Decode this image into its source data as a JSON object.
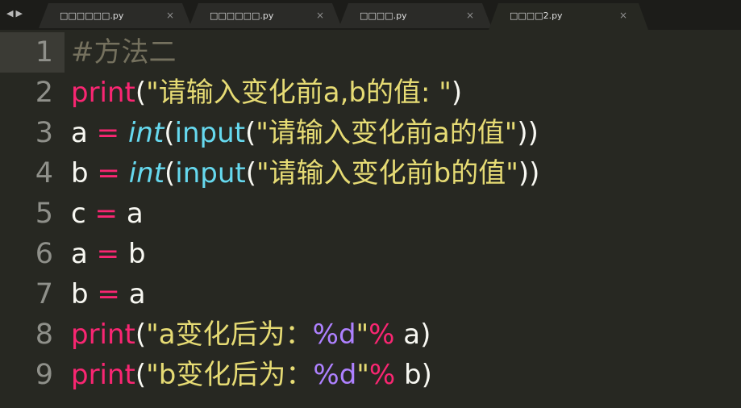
{
  "tabs": [
    {
      "label": "□□□□□□.py",
      "close": "×",
      "active": false
    },
    {
      "label": "□□□□□□.py",
      "close": "×",
      "active": false
    },
    {
      "label": "□□□□.py",
      "close": "×",
      "active": false
    },
    {
      "label": "□□□□2.py",
      "close": "×",
      "active": true
    }
  ],
  "nav": {
    "prev": "◀",
    "next": "▶"
  },
  "lines": [
    {
      "num": "1",
      "segs": [
        {
          "t": "#方法二",
          "c": "cmt"
        }
      ]
    },
    {
      "num": "2",
      "segs": [
        {
          "t": "print",
          "c": "kw"
        },
        {
          "t": "(",
          "c": ""
        },
        {
          "t": "\"请输入变化前a,b的值: \"",
          "c": "str"
        },
        {
          "t": ")",
          "c": ""
        }
      ]
    },
    {
      "num": "3",
      "segs": [
        {
          "t": "a ",
          "c": ""
        },
        {
          "t": "=",
          "c": "kw"
        },
        {
          "t": " ",
          "c": ""
        },
        {
          "t": "int",
          "c": "fn italic"
        },
        {
          "t": "(",
          "c": ""
        },
        {
          "t": "input",
          "c": "fn"
        },
        {
          "t": "(",
          "c": ""
        },
        {
          "t": "\"请输入变化前a的值\"",
          "c": "str"
        },
        {
          "t": "))",
          "c": ""
        }
      ]
    },
    {
      "num": "4",
      "segs": [
        {
          "t": "b ",
          "c": ""
        },
        {
          "t": "=",
          "c": "kw"
        },
        {
          "t": " ",
          "c": ""
        },
        {
          "t": "int",
          "c": "fn italic"
        },
        {
          "t": "(",
          "c": ""
        },
        {
          "t": "input",
          "c": "fn"
        },
        {
          "t": "(",
          "c": ""
        },
        {
          "t": "\"请输入变化前b的值\"",
          "c": "str"
        },
        {
          "t": "))",
          "c": ""
        }
      ]
    },
    {
      "num": "5",
      "segs": [
        {
          "t": "c ",
          "c": ""
        },
        {
          "t": "=",
          "c": "kw"
        },
        {
          "t": " a",
          "c": ""
        }
      ]
    },
    {
      "num": "6",
      "segs": [
        {
          "t": "a ",
          "c": ""
        },
        {
          "t": "=",
          "c": "kw"
        },
        {
          "t": " b",
          "c": ""
        }
      ]
    },
    {
      "num": "7",
      "segs": [
        {
          "t": "b ",
          "c": ""
        },
        {
          "t": "=",
          "c": "kw"
        },
        {
          "t": " a",
          "c": ""
        }
      ]
    },
    {
      "num": "8",
      "segs": [
        {
          "t": "print",
          "c": "kw"
        },
        {
          "t": "(",
          "c": ""
        },
        {
          "t": "\"a变化后为：",
          "c": "str"
        },
        {
          "t": "%d",
          "c": "fmt"
        },
        {
          "t": "\"",
          "c": "str"
        },
        {
          "t": "%",
          "c": "kw"
        },
        {
          "t": " a)",
          "c": ""
        }
      ]
    },
    {
      "num": "9",
      "segs": [
        {
          "t": "print",
          "c": "kw"
        },
        {
          "t": "(",
          "c": ""
        },
        {
          "t": "\"b变化后为：",
          "c": "str"
        },
        {
          "t": "%d",
          "c": "fmt"
        },
        {
          "t": "\"",
          "c": "str"
        },
        {
          "t": "%",
          "c": "kw"
        },
        {
          "t": " b)",
          "c": ""
        }
      ]
    }
  ],
  "theme": {
    "background": "#272822",
    "keyword": "#f92672",
    "string": "#e6db74",
    "builtin": "#66d9ef",
    "comment": "#75715e",
    "format": "#ae81ff"
  }
}
